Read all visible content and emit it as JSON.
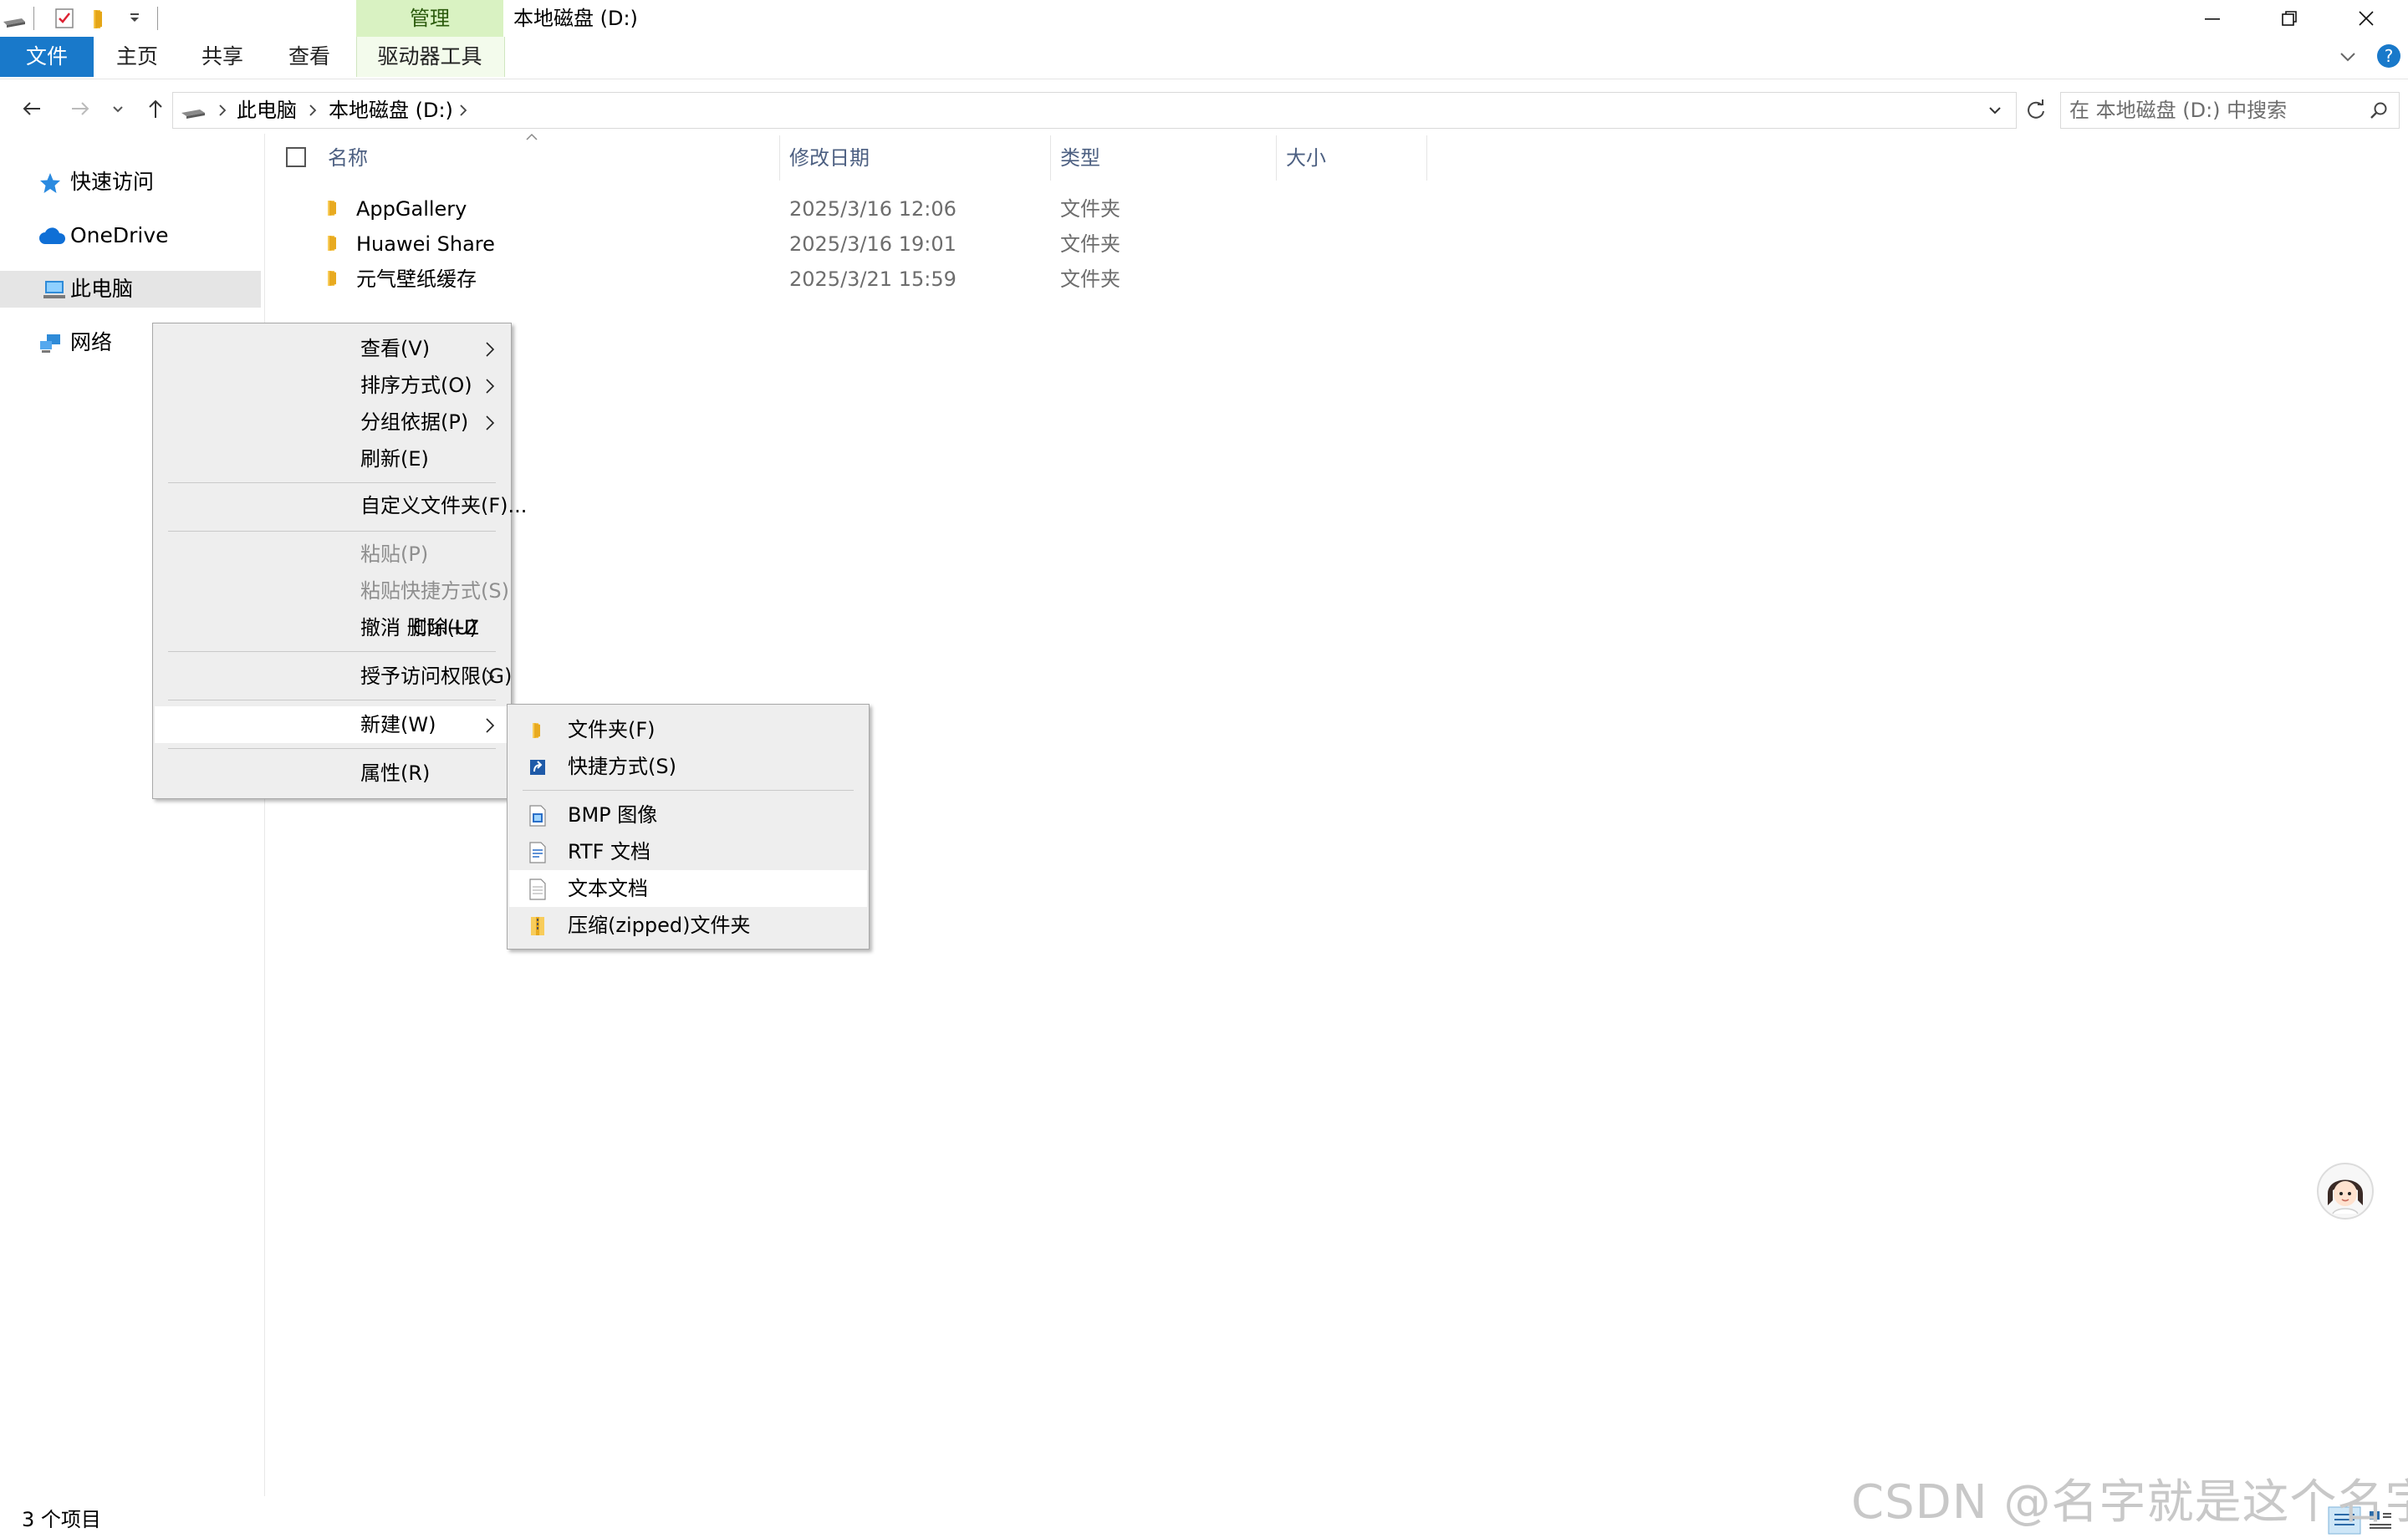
{
  "window": {
    "title": "本地磁盘 (D:)",
    "context_tab": "管理"
  },
  "ribbon": {
    "tabs": [
      "文件",
      "主页",
      "共享",
      "查看",
      "驱动器工具"
    ]
  },
  "address": {
    "crumbs": [
      "此电脑",
      "本地磁盘 (D:)"
    ],
    "search_placeholder": "在 本地磁盘 (D:) 中搜索"
  },
  "nav": {
    "items": [
      "快速访问",
      "OneDrive",
      "此电脑",
      "网络"
    ]
  },
  "columns": {
    "name": "名称",
    "date": "修改日期",
    "type": "类型",
    "size": "大小"
  },
  "files": [
    {
      "name": "AppGallery",
      "date": "2025/3/16 12:06",
      "type": "文件夹"
    },
    {
      "name": "Huawei Share",
      "date": "2025/3/16 19:01",
      "type": "文件夹"
    },
    {
      "name": "元气壁纸缓存",
      "date": "2025/3/21 15:59",
      "type": "文件夹"
    }
  ],
  "context_menu": {
    "items": [
      {
        "label": "查看(V)"
      },
      {
        "label": "排序方式(O)"
      },
      {
        "label": "分组依据(P)"
      },
      {
        "label": "刷新(E)"
      },
      {
        "label": "自定义文件夹(F)..."
      },
      {
        "label": "粘贴(P)"
      },
      {
        "label": "粘贴快捷方式(S)"
      },
      {
        "label": "撤消 删除(U)",
        "shortcut": "Ctrl+Z"
      },
      {
        "label": "授予访问权限(G)"
      },
      {
        "label": "新建(W)"
      },
      {
        "label": "属性(R)"
      }
    ]
  },
  "new_submenu": {
    "items": [
      {
        "label": "文件夹(F)",
        "icon": "folder-icon"
      },
      {
        "label": "快捷方式(S)",
        "icon": "shortcut-icon"
      },
      {
        "label": "BMP 图像",
        "icon": "bmp-file-icon"
      },
      {
        "label": "RTF 文档",
        "icon": "rtf-file-icon"
      },
      {
        "label": "文本文档",
        "icon": "text-file-icon"
      },
      {
        "label": "压缩(zipped)文件夹",
        "icon": "zip-folder-icon"
      }
    ]
  },
  "status": {
    "count": "3 个项目"
  },
  "watermark": "CSDN @名字就是这个名字",
  "colors": {
    "file_tab": "#1979ca",
    "manage_tab": "#d9f2c2",
    "selection": "#e5e5e5",
    "menu_bg": "#eeeeee"
  }
}
